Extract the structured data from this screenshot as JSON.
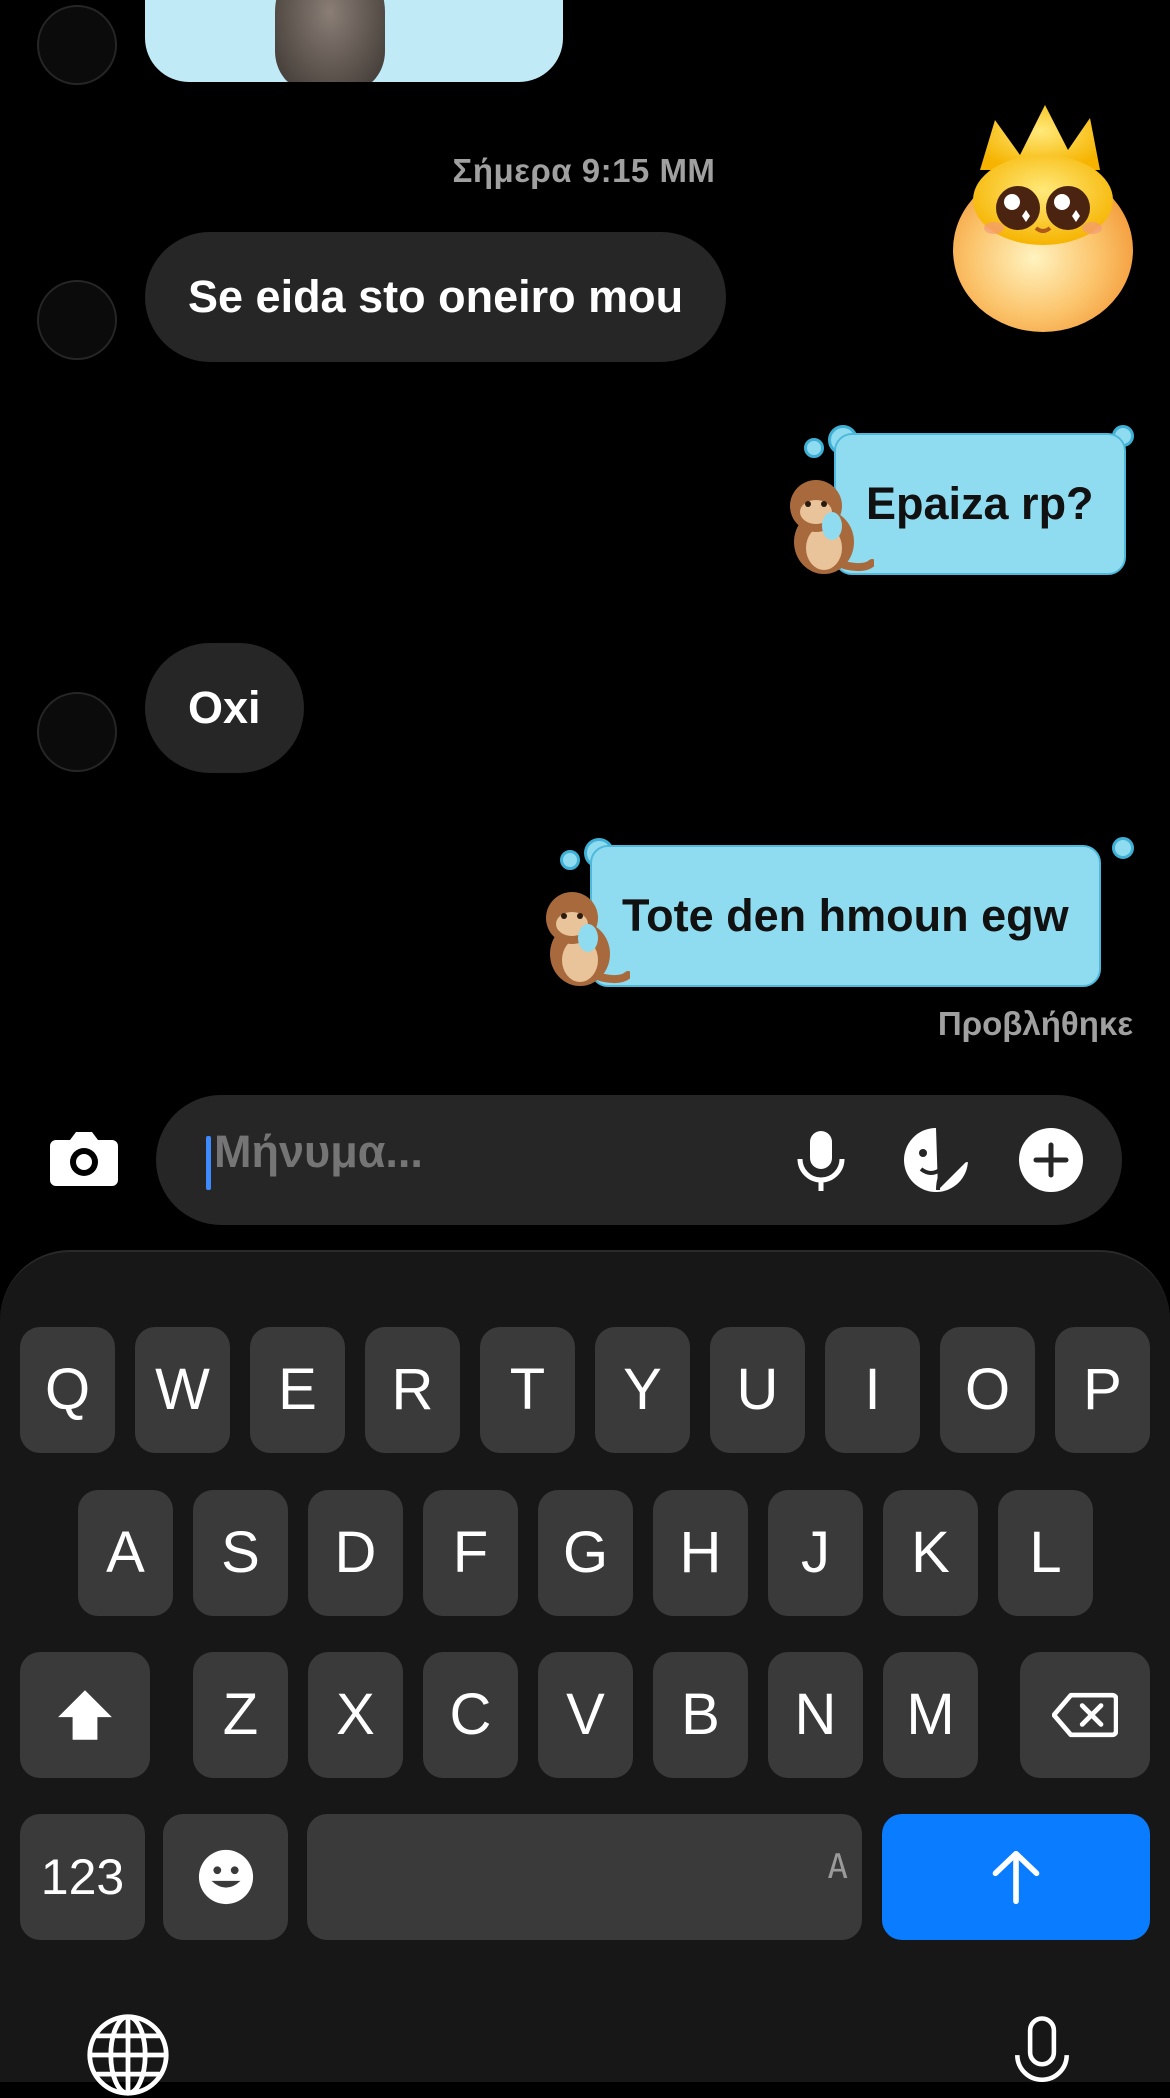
{
  "messages": {
    "timestamp": "Σήμερα 9:15 ΜΜ",
    "incoming_1": "Se eida sto oneiro mou",
    "outgoing_1": "Epaiza rp?",
    "incoming_2": "Oxi",
    "outgoing_2": "Tote den hmoun egw",
    "seen_status": "Προβλήθηκε"
  },
  "composer": {
    "placeholder": "Μήνυμα...",
    "icons": [
      "camera-icon",
      "microphone-icon",
      "sticker-icon",
      "plus-icon"
    ]
  },
  "keyboard": {
    "row1": [
      "Q",
      "W",
      "E",
      "R",
      "T",
      "Y",
      "U",
      "I",
      "O",
      "P"
    ],
    "row2": [
      "A",
      "S",
      "D",
      "F",
      "G",
      "H",
      "J",
      "K",
      "L"
    ],
    "row3": [
      "Z",
      "X",
      "C",
      "V",
      "B",
      "N",
      "M"
    ],
    "numbers_label": "123",
    "space_hint": "A",
    "icons": [
      "shift-icon",
      "backspace-icon",
      "emoji-icon",
      "send-arrow-icon",
      "globe-icon",
      "dictation-mic-icon"
    ]
  },
  "colors": {
    "background": "#000000",
    "incoming_bubble": "#262626",
    "outgoing_bubble": "#8fdcf0",
    "send_key": "#0a7cff",
    "caret": "#3d8bff"
  }
}
